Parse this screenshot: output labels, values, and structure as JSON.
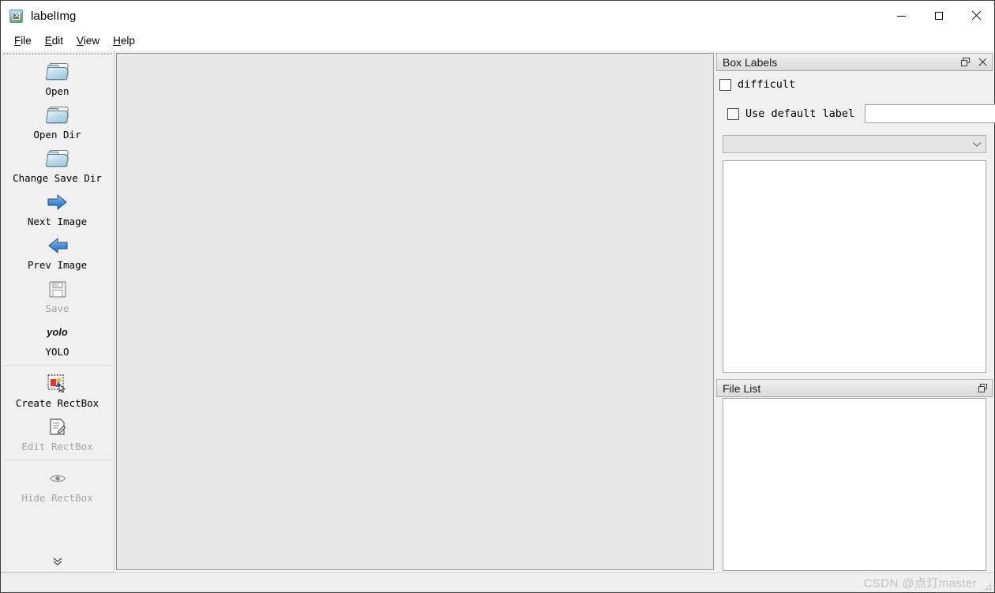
{
  "window": {
    "title": "labelImg",
    "app_icon": "image-label-icon",
    "controls": {
      "minimize": "minimize-icon",
      "maximize": "maximize-icon",
      "close": "close-icon"
    }
  },
  "menubar": {
    "items": [
      {
        "label": "File",
        "mnemonic": "F",
        "rest": "ile"
      },
      {
        "label": "Edit",
        "mnemonic": "E",
        "rest": "dit"
      },
      {
        "label": "View",
        "mnemonic": "V",
        "rest": "iew"
      },
      {
        "label": "Help",
        "mnemonic": "H",
        "rest": "elp"
      }
    ]
  },
  "toolbar": {
    "items": [
      {
        "label": "Open",
        "icon": "folder-open-icon",
        "enabled": true
      },
      {
        "label": "Open Dir",
        "icon": "folder-open-dir-icon",
        "enabled": true
      },
      {
        "label": "Change Save Dir",
        "icon": "folder-change-save-dir-icon",
        "enabled": true
      },
      {
        "label": "Next Image",
        "icon": "arrow-right-icon",
        "enabled": true
      },
      {
        "label": "Prev Image",
        "icon": "arrow-left-icon",
        "enabled": true
      },
      {
        "label": "Save",
        "icon": "floppy-save-icon",
        "enabled": false
      },
      {
        "label": "YOLO",
        "icon": "yolo-format-icon",
        "icon_text": "yolo",
        "enabled": true
      },
      {
        "label": "Create RectBox",
        "icon": "create-rectbox-icon",
        "enabled": true
      },
      {
        "label": "Edit RectBox",
        "icon": "edit-rectbox-icon",
        "enabled": false
      },
      {
        "label": "Hide RectBox",
        "icon": "hide-rectbox-eye-icon",
        "enabled": false
      }
    ],
    "expand_label": "⌄⌄",
    "expand_icon": "double-chevron-down-icon"
  },
  "canvas": {
    "name": "image-canvas",
    "background": "#e8e8e8",
    "content": ""
  },
  "box_labels": {
    "title": "Box Labels",
    "float_icon": "float-panel-icon",
    "close_icon": "close-panel-icon",
    "difficult": {
      "label": "difficult",
      "checked": false
    },
    "use_default_label": {
      "label": "Use default label",
      "checked": false,
      "input_value": "",
      "input_placeholder": ""
    },
    "combo": {
      "selected": "",
      "enabled": false,
      "arrow_icon": "chevron-down-icon"
    },
    "label_list_items": []
  },
  "file_list": {
    "title": "File List",
    "float_icon": "float-panel-icon",
    "items": []
  },
  "statusbar": {
    "watermark": "CSDN @点灯master",
    "grip_icon": "resize-grip-icon"
  },
  "colors": {
    "window_bg": "#f0f0f0",
    "canvas_bg": "#e8e8e8",
    "panel_title_bg": "#e3e3e3",
    "text": "#000000",
    "disabled_text": "#a6a6a6",
    "watermark": "#c2c2c2"
  }
}
